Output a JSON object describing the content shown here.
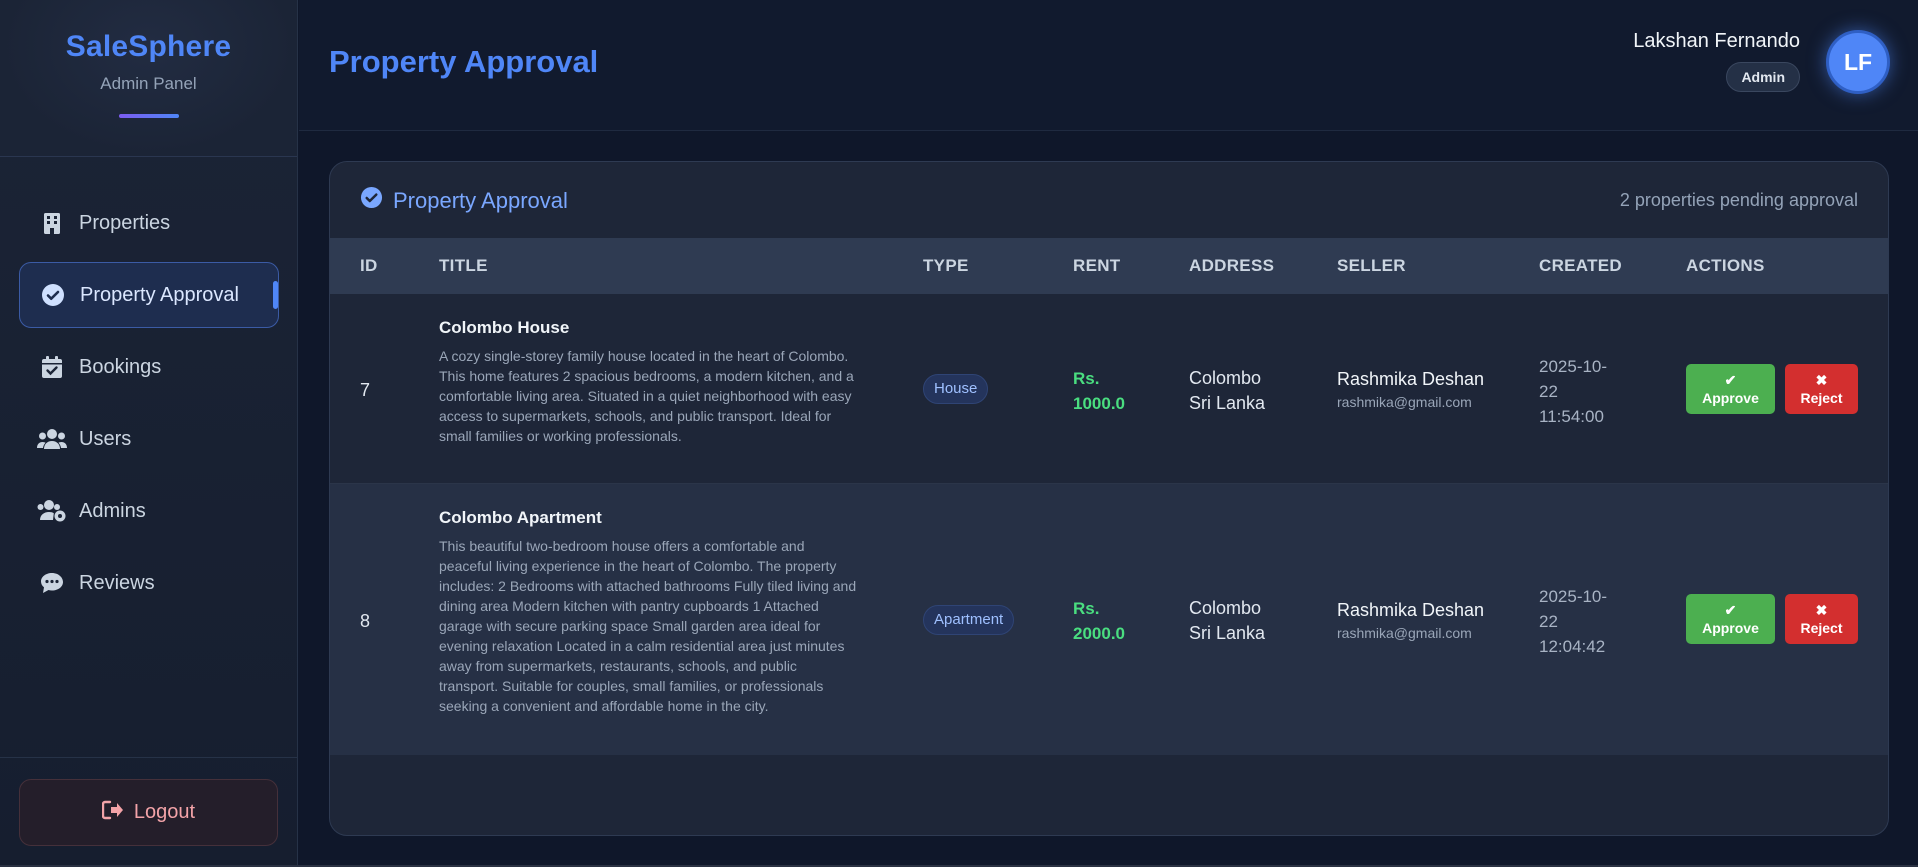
{
  "brand": {
    "name": "SaleSphere",
    "subtitle": "Admin Panel"
  },
  "sidebar": {
    "items": [
      {
        "label": "Properties",
        "icon": "building-icon",
        "active": false
      },
      {
        "label": "Property Approval",
        "icon": "check-circle-icon",
        "active": true
      },
      {
        "label": "Bookings",
        "icon": "calendar-check-icon",
        "active": false
      },
      {
        "label": "Users",
        "icon": "users-icon",
        "active": false
      },
      {
        "label": "Admins",
        "icon": "users-cog-icon",
        "active": false
      },
      {
        "label": "Reviews",
        "icon": "comment-dots-icon",
        "active": false
      }
    ],
    "logout": "Logout"
  },
  "header": {
    "title": "Property Approval",
    "user_name": "Lakshan Fernando",
    "user_role": "Admin",
    "avatar_initials": "LF"
  },
  "card": {
    "title": "Property Approval",
    "pending_text": "2 properties pending approval"
  },
  "table": {
    "headers": [
      "ID",
      "TITLE",
      "TYPE",
      "RENT",
      "ADDRESS",
      "SELLER",
      "CREATED",
      "ACTIONS"
    ],
    "rows": [
      {
        "id": "7",
        "title": "Colombo House",
        "description": "A cozy single-storey family house located in the heart of Colombo. This home features 2 spacious bedrooms, a modern kitchen, and a comfortable living area. Situated in a quiet neighborhood with easy access to supermarkets, schools, and public transport. Ideal for small families or working professionals.",
        "type": "House",
        "rent_line1": "Rs.",
        "rent_line2": "1000.0",
        "address_line1": "Colombo",
        "address_line2": "Sri Lanka",
        "seller_name": "Rashmika Deshan",
        "seller_email": "rashmika@gmail.com",
        "created_line1": "2025-10-",
        "created_line2": "22",
        "created_line3": "11:54:00",
        "approve_label": "Approve",
        "reject_label": "Reject"
      },
      {
        "id": "8",
        "title": "Colombo Apartment",
        "description": "This beautiful two-bedroom house offers a comfortable and peaceful living experience in the heart of Colombo. The property includes: 2 Bedrooms with attached bathrooms Fully tiled living and dining area Modern kitchen with pantry cupboards 1 Attached garage with secure parking space Small garden area ideal for evening relaxation Located in a calm residential area just minutes away from supermarkets, restaurants, schools, and public transport. Suitable for couples, small families, or professionals seeking a convenient and affordable home in the city.",
        "type": "Apartment",
        "rent_line1": "Rs.",
        "rent_line2": "2000.0",
        "address_line1": "Colombo",
        "address_line2": "Sri Lanka",
        "seller_name": "Rashmika Deshan",
        "seller_email": "rashmika@gmail.com",
        "created_line1": "2025-10-",
        "created_line2": "22",
        "created_line3": "12:04:42",
        "approve_label": "Approve",
        "reject_label": "Reject"
      }
    ]
  },
  "colors": {
    "accent": "#4f86f7",
    "approve": "#4caf50",
    "reject": "#d32f2f",
    "rent": "#4ade80"
  }
}
